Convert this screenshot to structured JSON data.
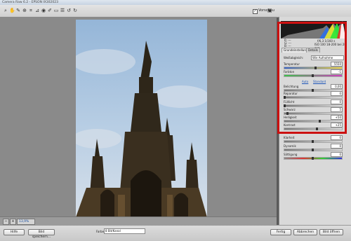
{
  "window": {
    "title": "Camera Raw 6.2 - EPSON IX302023"
  },
  "toolbar": {
    "tools": [
      "zoom-icon",
      "hand-icon",
      "eyedropper-icon",
      "target-icon",
      "crop-icon",
      "straighten-icon",
      "redeye-icon",
      "brush-icon",
      "gradient-icon",
      "prefs-icon",
      "rotate-ccw-icon",
      "rotate-cw-icon"
    ],
    "preview_label": "Vorschau",
    "preview_checked": true
  },
  "image": {
    "caption": "Rezkdfilm.jpg"
  },
  "zoom": {
    "value": "13,9%"
  },
  "histogram": {
    "info_left": [
      "R:  ---",
      "G:  ---",
      "B:  ---"
    ],
    "info_right_top": "f/6,3   1/160 s",
    "info_right_bottom": "ISO 100   18-200 bei 28 mm"
  },
  "tabs": [
    {
      "label": "Grundeinstellungen"
    },
    {
      "label": "Details"
    }
  ],
  "basic": {
    "wb_label": "Weißabgleich:",
    "wb_value": "Wie Aufnahme",
    "temperature_label": "Temperatur",
    "temperature_value": "5550",
    "tint_label": "Farbton",
    "tint_value": "-1",
    "auto_link": "Auto",
    "default_link": "Standard",
    "exposure_label": "Belichtung",
    "exposure_value": "0,00",
    "recovery_label": "Reparatur",
    "recovery_value": "0",
    "fill_label": "Fülllicht",
    "fill_value": "0",
    "blacks_label": "Schwarz",
    "blacks_value": "5",
    "brightness_label": "Helligkeit",
    "brightness_value": "+50",
    "contrast_label": "Kontrast",
    "contrast_value": "+25",
    "clarity_label": "Klarheit",
    "clarity_value": "0",
    "vibrance_label": "Dynamik",
    "vibrance_value": "0",
    "saturation_label": "Sättigung",
    "saturation_value": "0"
  },
  "bottom": {
    "help": "Hilfe",
    "save": "Bild speichern...",
    "format_label": "Farbe:",
    "format_value": "8 Bit/Kanal",
    "done": "Fertig",
    "cancel": "Abbrechen",
    "open": "Bild öffnen"
  },
  "colors": {
    "annotation": "#cc1111",
    "link": "#1b54b8",
    "background": "#5a5a5a"
  }
}
